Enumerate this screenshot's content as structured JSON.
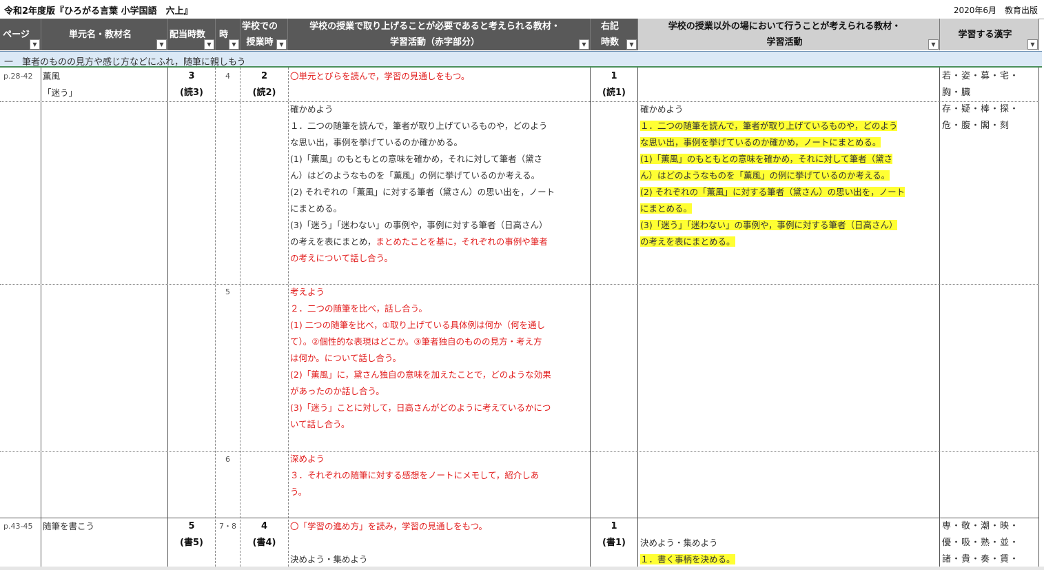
{
  "title": "令和2年度版『ひろがる言葉 小学国語　六上』",
  "publisher": "2020年6月　教育出版",
  "headers": {
    "page": "ページ",
    "unit": "単元名・教材名",
    "hours": "配当時数",
    "ji": "時",
    "school_l1": "学校での",
    "school_l2": "授業時",
    "content_l1": "学校の授業で取り上げることが必要であると考えられる教材・",
    "content_l2": "学習活動（赤字部分）",
    "right_l1": "右記",
    "right_l2": "時数",
    "outside_l1": "学校の授業以外の場において行うことが考えられる教材・",
    "outside_l2": "学習活動",
    "kanji": "学習する漢字"
  },
  "section": "一　筆者のものの見方や感じ方などにふれ，随筆に親しもう",
  "rows": {
    "r1": {
      "page": "p.28-42",
      "unit1": "薫風",
      "unit2": "「迷う」",
      "hours1": "3",
      "hours2": "(読3)",
      "ji": "4",
      "school1": "2",
      "school2": "(読2)",
      "content": "〇単元とびらを読んで，学習の見通しをもつ。",
      "right1": "1",
      "right2": "(読1)",
      "kanji1": "若・姿・募・宅・",
      "kanji2": "胸・臓"
    },
    "r2": {
      "content": [
        "確かめよう",
        "１．二つの随筆を読んで，筆者が取り上げているものや，どのよう",
        "な思い出，事例を挙げているのか確かめる。",
        "(1)「薫風」のもともとの意味を確かめ，それに対して筆者（黛さ",
        "ん）はどのようなものを「薫風」の例に挙げているのか考える。",
        "(2) それぞれの「薫風」に対する筆者（黛さん）の思い出を，ノート",
        "にまとめる。",
        "(3)「迷う」「迷わない」の事例や，事例に対する筆者（日高さん）",
        "の考えを表にまとめ，"
      ],
      "content_red_tail": "まとめたことを基に，それぞれの事例や筆者",
      "content_red_last": "の考えについて話し合う。",
      "outside": [
        "確かめよう",
        "１．二つの随筆を読んで，筆者が取り上げているものや，どのよう",
        "な思い出，事例を挙げているのか確かめ，ノートにまとめる。",
        "(1)「薫風」のもともとの意味を確かめ，それに対して筆者（黛さ",
        "ん）はどのようなものを「薫風」の例に挙げているのか考える。",
        "(2) それぞれの「薫風」に対する筆者（黛さん）の思い出を，ノート",
        "にまとめる。",
        "(3)「迷う」「迷わない」の事例や，事例に対する筆者（日高さん）",
        "の考えを表にまとめる。"
      ],
      "kanji1": "存・疑・棒・探・",
      "kanji2": "危・腹・閣・刻"
    },
    "r3": {
      "ji": "5",
      "content": [
        "考えよう",
        "２．二つの随筆を比べ，話し合う。",
        "(1) 二つの随筆を比べ，①取り上げている具体例は何か（何を通し",
        "て）。②個性的な表現はどこか。③筆者独自のものの見方・考え方",
        "は何か。について話し合う。",
        "(2)「薫風」に，黛さん独自の意味を加えたことで，どのような効果",
        "があったのか話し合う。",
        "(3)「迷う」ことに対して，日高さんがどのように考えているかにつ",
        "いて話し合う。"
      ]
    },
    "r4": {
      "ji": "6",
      "content": [
        "深めよう",
        "３．それぞれの随筆に対する感想をノートにメモして，紹介しあ",
        "う。"
      ]
    },
    "r5": {
      "page": "p.43-45",
      "unit1": "随筆を書こう",
      "hours1": "5",
      "hours2": "(書5)",
      "ji": "7・8",
      "school1": "4",
      "school2": "(書4)",
      "content1": "〇「学習の進め方」を読み，学習の見通しをもつ。",
      "content2": "決めよう・集めよう",
      "right1": "1",
      "right2": "(書1)",
      "outside1": "決めよう・集めよう",
      "outside2": "１．書く事柄を決める。",
      "kanji1": "専・敬・潮・映・",
      "kanji2": "優・吸・熟・並・",
      "kanji3": "諸・貴・奏・賃・"
    }
  },
  "colors": {
    "header_dark": "#595959",
    "header_light": "#d0d0d0",
    "highlight": "#ffff33",
    "red_text": "#e21d1d",
    "section_bg": "#dbe9f6"
  },
  "icons": {
    "filter": "dropdown-filter-icon"
  }
}
